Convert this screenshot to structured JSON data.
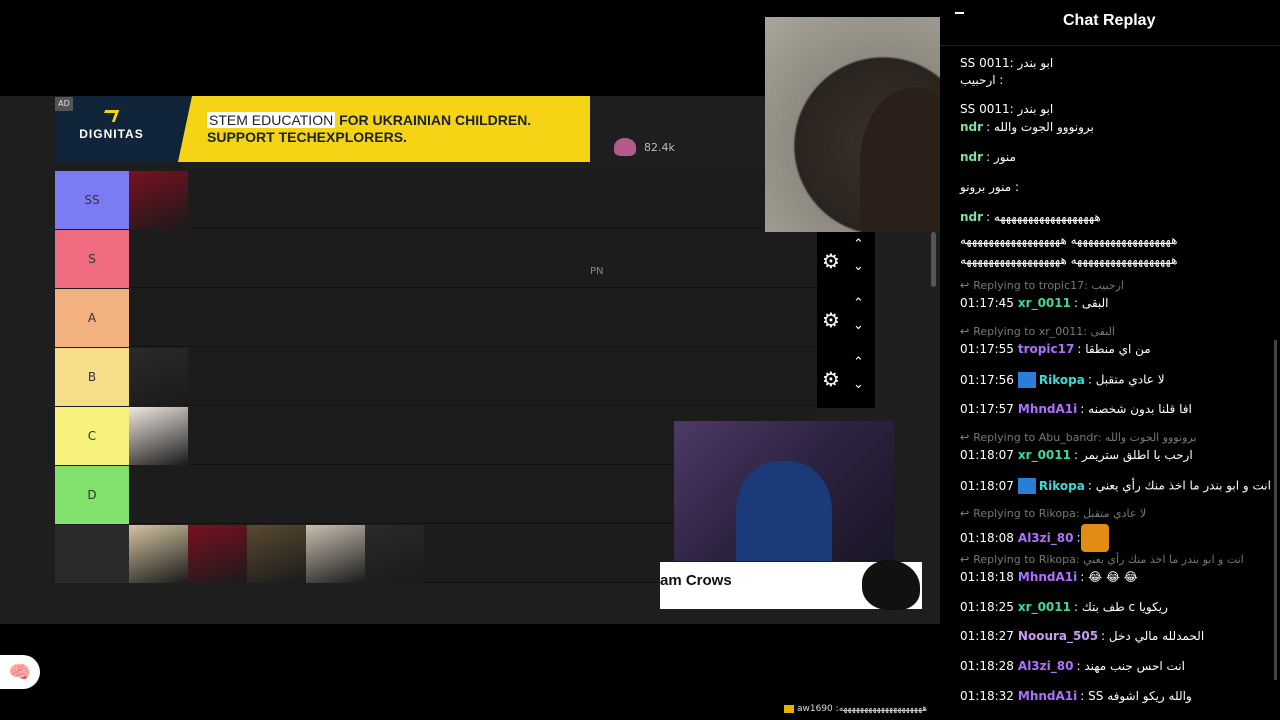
{
  "ad": {
    "badge": "AD",
    "brand": "DIGNITAS",
    "highlight": "STEM EDUCATION",
    "line1_rest": " FOR UKRAINIAN CHILDREN.",
    "line2": "SUPPORT TECHEXPLORERS."
  },
  "likes": "82.4k",
  "tiers": [
    {
      "label": "SS",
      "color": "#7b7cf4",
      "items": 1
    },
    {
      "label": "S",
      "color": "#ef6b80",
      "items": 0
    },
    {
      "label": "A",
      "color": "#f3b180",
      "items": 0
    },
    {
      "label": "B",
      "color": "#f6dd8a",
      "items": 1
    },
    {
      "label": "C",
      "color": "#f7f27b",
      "items": 1
    },
    {
      "label": "D",
      "color": "#80e26a",
      "items": 0
    },
    {
      "label": "",
      "color": "#2a2a2a",
      "items": 5
    }
  ],
  "pn_text": "PN",
  "cam_label": "am Crows",
  "ticker": {
    "user": "aw1690",
    "text": ":ههههههههههههههههههههه"
  },
  "chat": {
    "title": "Chat Replay",
    "messages": [
      {
        "type": "msg",
        "time": "",
        "user": "",
        "user_color": "#aaa",
        "text": "SS ابو بندر :0011"
      },
      {
        "type": "msg",
        "time": "",
        "user": "",
        "user_color": "#aaa",
        "text": "ارحبيب :"
      },
      {
        "type": "msg",
        "time": "",
        "user": "",
        "user_color": "#aaa",
        "text": "SS ابو بندر :0011"
      },
      {
        "type": "msg",
        "time": "",
        "user": "ndr",
        "user_color": "#7fe0a0",
        "text": ": برونووو الجوت والله"
      },
      {
        "type": "msg",
        "time": "",
        "user": "ndr",
        "user_color": "#7fe0a0",
        "text": ": منور"
      },
      {
        "type": "msg",
        "time": "",
        "user": "",
        "user_color": "#aaa",
        "text": "منور برونو :"
      },
      {
        "type": "msg",
        "time": "",
        "user": "ndr",
        "user_color": "#7fe0a0",
        "text": ": ههههههههههههههههههه"
      },
      {
        "type": "msg",
        "time": "",
        "user": "",
        "user_color": "#aaa",
        "text": "ههههههههههههههههههه ههههههههههههههههههه"
      },
      {
        "type": "msg",
        "time": "",
        "user": "",
        "user_color": "#aaa",
        "text": "ههههههههههههههههههه ههههههههههههههههههه"
      },
      {
        "type": "reply",
        "text": "Replying to tropic17: ارحبيب"
      },
      {
        "type": "msg",
        "time": "01:17:45",
        "user": "xr_0011",
        "user_color": "#3ed8a0",
        "text": ": البقى"
      },
      {
        "type": "reply",
        "text": "Replying to xr_0011: البقى"
      },
      {
        "type": "msg",
        "time": "01:17:55",
        "user": "tropic17",
        "user_color": "#b070ff",
        "text": ": من اي منطقا"
      },
      {
        "type": "msg",
        "time": "01:17:56",
        "user": "Rikopa",
        "user_color": "#3ed8d8",
        "text": ": لا عادي متقبل",
        "badge": true
      },
      {
        "type": "msg",
        "time": "01:17:57",
        "user": "MhndA1i",
        "user_color": "#b070ff",
        "text": ": افا قلنا بدون شخصنه"
      },
      {
        "type": "reply",
        "text": "Replying to Abu_bandr: برونووو الجوت والله"
      },
      {
        "type": "msg",
        "time": "01:18:07",
        "user": "xr_0011",
        "user_color": "#3ed8a0",
        "text": ": ارحب يا اطلق ستريمر"
      },
      {
        "type": "msg",
        "time": "01:18:07",
        "user": "Rikopa",
        "user_color": "#3ed8d8",
        "text": ": انت و ابو بندر ما اخذ منك رأي يعني",
        "badge": true
      },
      {
        "type": "reply",
        "text": "Replying to Rikopa: لا عادي متقبل"
      },
      {
        "type": "msg",
        "time": "01:18:08",
        "user": "Al3zi_80",
        "user_color": "#b070ff",
        "text": ":",
        "fire": true
      },
      {
        "type": "reply",
        "text": "Replying to Rikopa: انت و ابو بندر ما اخذ منك رأي يعني"
      },
      {
        "type": "msg",
        "time": "01:18:18",
        "user": "MhndA1i",
        "user_color": "#b070ff",
        "text": ": 😂 😂 😂"
      },
      {
        "type": "msg",
        "time": "01:18:25",
        "user": "xr_0011",
        "user_color": "#3ed8a0",
        "text": ": طف بتك c ريكويا"
      },
      {
        "type": "msg",
        "time": "01:18:27",
        "user": "Nooura_505",
        "user_color": "#c89cf0",
        "text": ": الحمدلله مالي دخل"
      },
      {
        "type": "msg",
        "time": "01:18:28",
        "user": "Al3zi_80",
        "user_color": "#b070ff",
        "text": ": انت احس جنب مهند"
      },
      {
        "type": "msg",
        "time": "01:18:32",
        "user": "MhndA1i",
        "user_color": "#b070ff",
        "text": ": SS والله ريكو اشوفه"
      }
    ]
  }
}
